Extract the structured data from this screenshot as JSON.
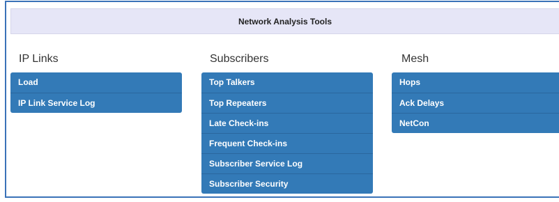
{
  "header": {
    "title": "Network Analysis Tools"
  },
  "columns": {
    "ip_links": {
      "title": "IP Links",
      "items": [
        "Load",
        "IP Link Service Log"
      ]
    },
    "subscribers": {
      "title": "Subscribers",
      "items": [
        "Top Talkers",
        "Top Repeaters",
        "Late Check-ins",
        "Frequent Check-ins",
        "Subscriber Service Log",
        "Subscriber Security"
      ]
    },
    "mesh": {
      "title": "Mesh",
      "items": [
        "Hops",
        "Ack Delays",
        "NetCon"
      ]
    }
  },
  "colors": {
    "accent": "#337ab7",
    "header_bg": "#e6e6f7",
    "frame": "#3a72b8"
  }
}
